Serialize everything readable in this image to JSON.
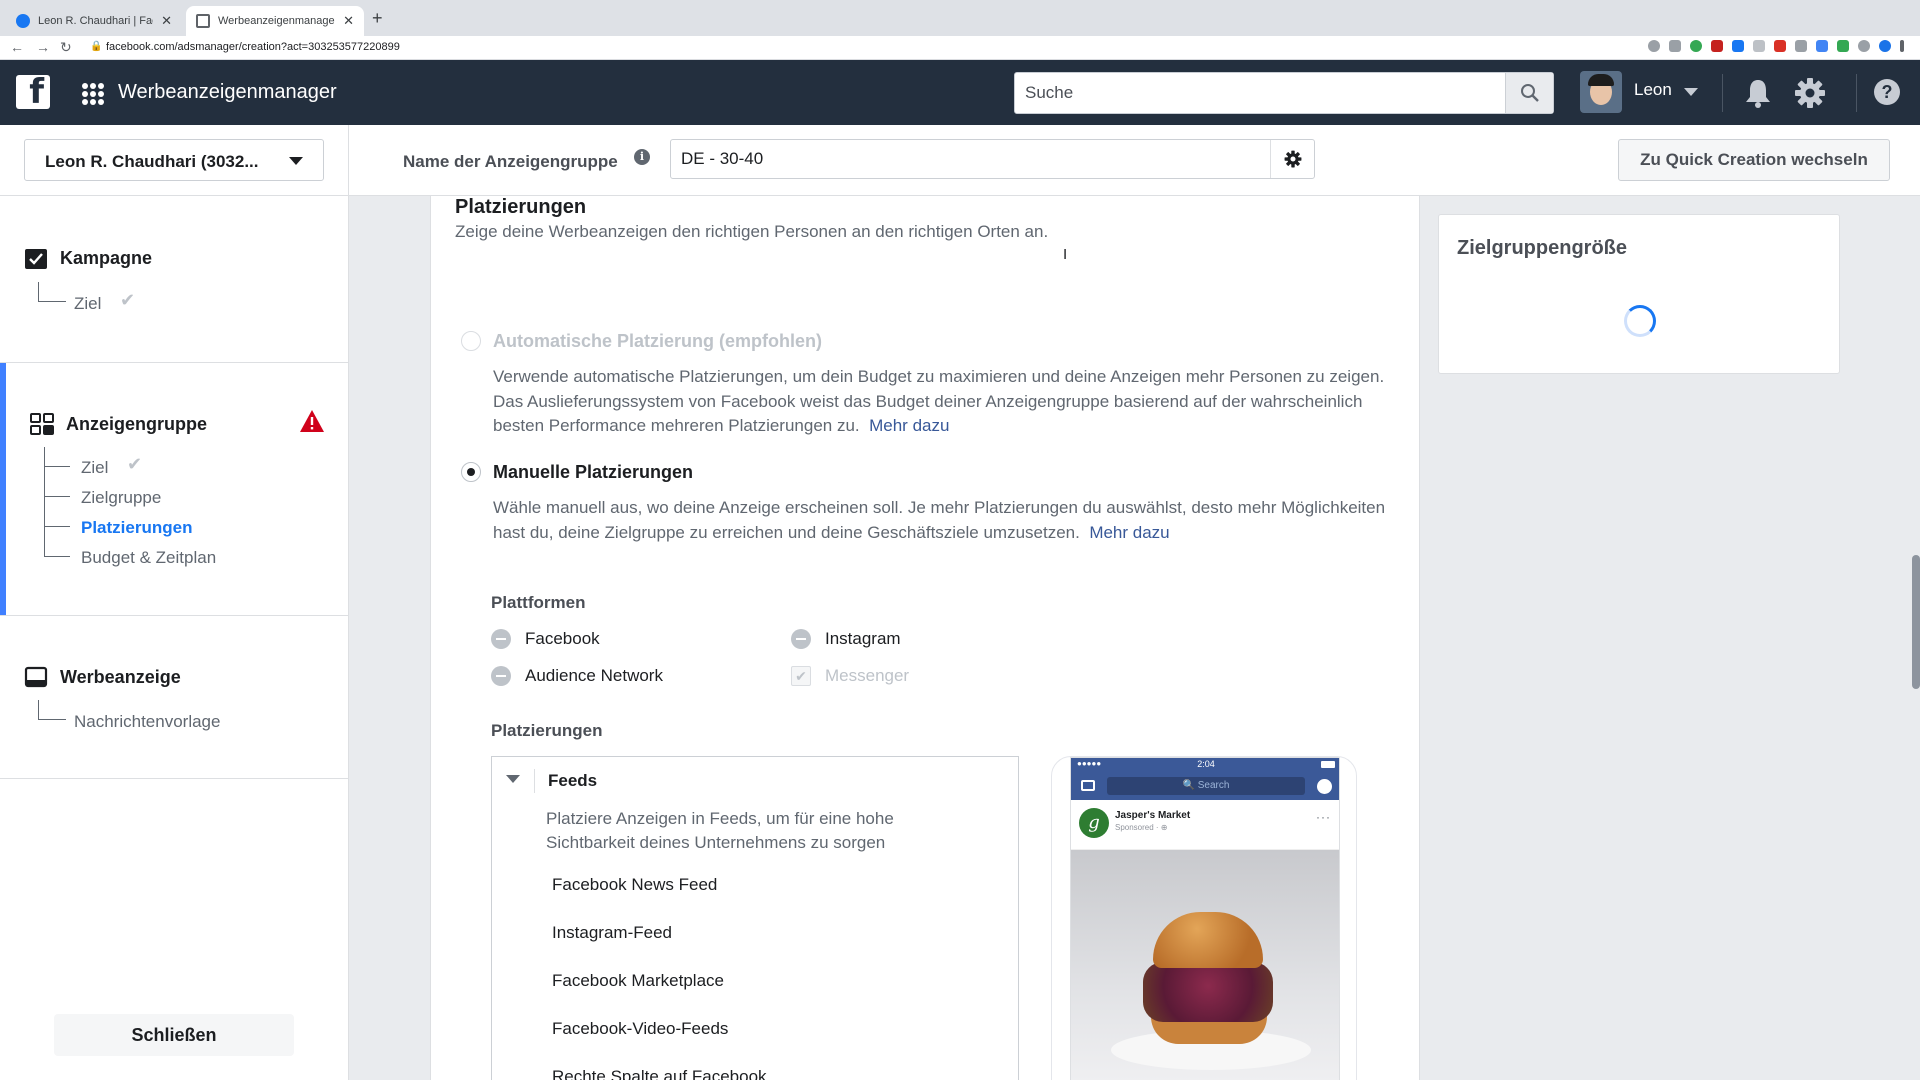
{
  "browser": {
    "tabs": [
      {
        "title": "Leon R. Chaudhari | Facebook",
        "active": false
      },
      {
        "title": "Werbeanzeigenmanager - Cre",
        "active": true
      }
    ],
    "url": "facebook.com/adsmanager/creation?act=303253577220899"
  },
  "topbar": {
    "app_title": "Werbeanzeigenmanager",
    "search_placeholder": "Suche",
    "user_name": "Leon",
    "help_label": "?"
  },
  "subheader": {
    "account": "Leon R. Chaudhari (3032...",
    "adset_name_label": "Name der Anzeigengruppe",
    "adset_name_value": "DE - 30-40",
    "quick_creation_label": "Zu Quick Creation wechseln"
  },
  "sidebar": {
    "campaign": {
      "title": "Kampagne",
      "items": [
        {
          "label": "Ziel",
          "done": true
        }
      ]
    },
    "adset": {
      "title": "Anzeigengruppe",
      "items": [
        {
          "label": "Ziel",
          "done": true
        },
        {
          "label": "Zielgruppe"
        },
        {
          "label": "Platzierungen",
          "current": true
        },
        {
          "label": "Budget & Zeitplan"
        }
      ]
    },
    "ad": {
      "title": "Werbeanzeige",
      "items": [
        {
          "label": "Nachrichtenvorlage"
        }
      ]
    },
    "close_label": "Schließen"
  },
  "main": {
    "section_title": "Platzierungen",
    "section_desc": "Zeige deine Werbeanzeigen den richtigen Personen an den richtigen Orten an.",
    "auto": {
      "label": "Automatische Platzierung (empfohlen)",
      "desc": "Verwende automatische Platzierungen, um dein Budget zu maximieren und deine Anzeigen mehr Personen zu zeigen. Das Auslieferungssystem von Facebook weist das Budget deiner Anzeigengruppe basierend auf der wahrscheinlich besten Performance mehreren Platzierungen zu.",
      "link": "Mehr dazu"
    },
    "manual": {
      "label": "Manuelle Platzierungen",
      "desc": "Wähle manuell aus, wo deine Anzeige erscheinen soll. Je mehr Platzierungen du auswählst, desto mehr Möglichkeiten hast du, deine Zielgruppe zu erreichen und deine Geschäftsziele umzusetzen.",
      "link": "Mehr dazu"
    },
    "platforms_label": "Plattformen",
    "platforms": [
      "Facebook",
      "Instagram",
      "Audience Network",
      "Messenger"
    ],
    "placements_label": "Platzierungen",
    "feeds": {
      "title": "Feeds",
      "desc": "Platziere Anzeigen in Feeds, um für eine hohe Sichtbarkeit deines Unternehmens zu sorgen",
      "items": [
        "Facebook News Feed",
        "Instagram-Feed",
        "Facebook Marketplace",
        "Facebook-Video-Feeds",
        "Rechte Spalte auf Facebook"
      ]
    }
  },
  "preview": {
    "time": "2:04",
    "search": "Search",
    "advertiser": "Jasper's Market",
    "sponsored": "Sponsored · ⊕",
    "logo_letter": "g",
    "dots": "···"
  },
  "right_panel": {
    "title": "Zielgruppengröße"
  }
}
